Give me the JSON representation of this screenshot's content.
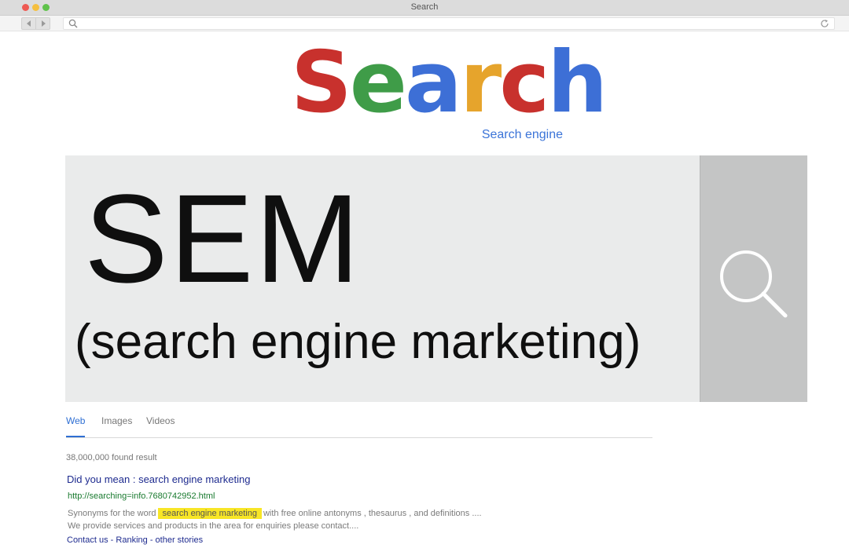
{
  "window": {
    "title": "Search"
  },
  "logo": {
    "letters": [
      {
        "char": "S",
        "color": "#c8312d"
      },
      {
        "char": "e",
        "color": "#3f9c48"
      },
      {
        "char": "a",
        "color": "#3d6fd6"
      },
      {
        "char": "r",
        "color": "#e6a42c"
      },
      {
        "char": "c",
        "color": "#c8312d"
      },
      {
        "char": "h",
        "color": "#3d6fd6"
      }
    ],
    "tagline": "Search engine"
  },
  "search_box": {
    "query_line1": "SEM",
    "query_line2": "(search engine marketing)",
    "button_icon": "magnifier-icon"
  },
  "tabs": [
    {
      "label": "Web",
      "active": true
    },
    {
      "label": "Images",
      "active": false
    },
    {
      "label": "Videos",
      "active": false
    }
  ],
  "results": {
    "count": "38,000,000 found result",
    "did_you_mean_label": "Did you mean :",
    "did_you_mean_term": "search engine marketing",
    "url": "http://searching=info.7680742952.html",
    "snippet_before": "Synonyms for the word",
    "snippet_highlight": "search engine marketing",
    "snippet_after": "with free online antonyms , thesaurus , and definitions ....",
    "snippet_line2": "We provide services and products in the area for enquiries please contact....",
    "links": [
      "Contact us",
      "Ranking",
      "other stories"
    ],
    "link_separator": "-"
  },
  "colors": {
    "accent_blue": "#2f6fd3",
    "link_navy": "#1e2b8f",
    "url_green": "#197a2f",
    "highlight_yellow": "#f8e626"
  }
}
